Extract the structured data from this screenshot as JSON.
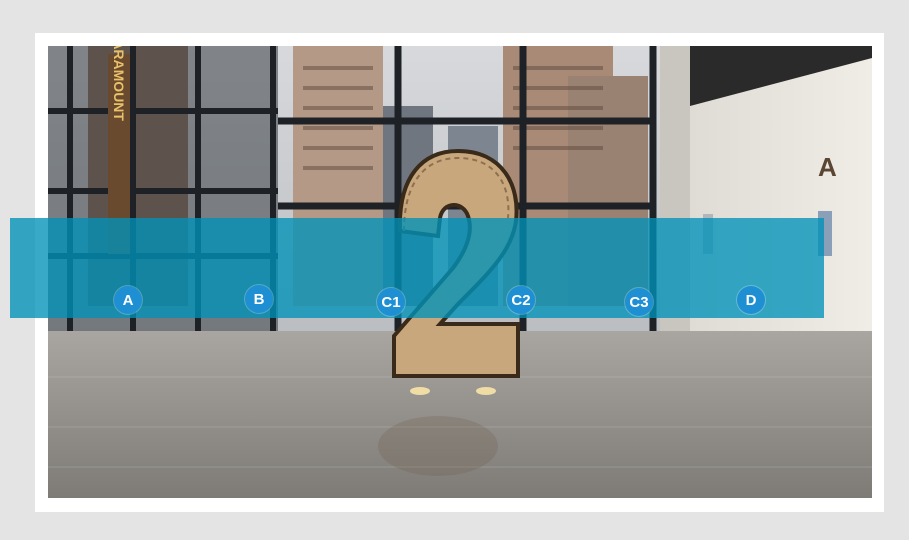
{
  "zone_markers": [
    {
      "id": "A",
      "label": "A"
    },
    {
      "id": "B",
      "label": "B"
    },
    {
      "id": "C1",
      "label": "C1"
    },
    {
      "id": "C2",
      "label": "C2"
    },
    {
      "id": "C3",
      "label": "C3"
    },
    {
      "id": "D",
      "label": "D"
    }
  ],
  "photo": {
    "sign_text": "PARAMOUNT",
    "sculpture_numeral": "2",
    "wall_letter": "A"
  },
  "colors": {
    "highlight_band": "#0092b8",
    "marker_fill": "#1f8fd3",
    "frame": "#ffffff",
    "background": "#e4e4e4"
  }
}
